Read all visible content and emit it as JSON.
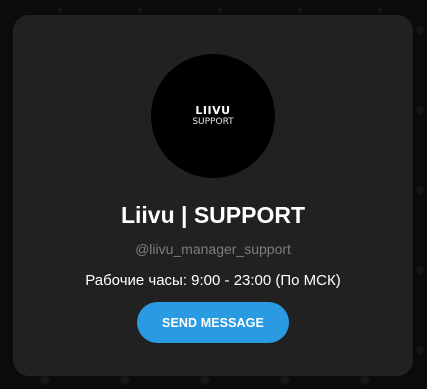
{
  "avatar": {
    "logo_name": "LIIVU",
    "logo_sub": "SUPPORT"
  },
  "profile": {
    "title": "Liivu | SUPPORT",
    "username": "@liivu_manager_support",
    "description": "Рабочие часы: 9:00 - 23:00 (По МСК)"
  },
  "actions": {
    "send_message_label": "SEND MESSAGE"
  },
  "colors": {
    "accent": "#2a9ae3",
    "card_background": "#212121",
    "page_background": "#0b0b0b"
  }
}
